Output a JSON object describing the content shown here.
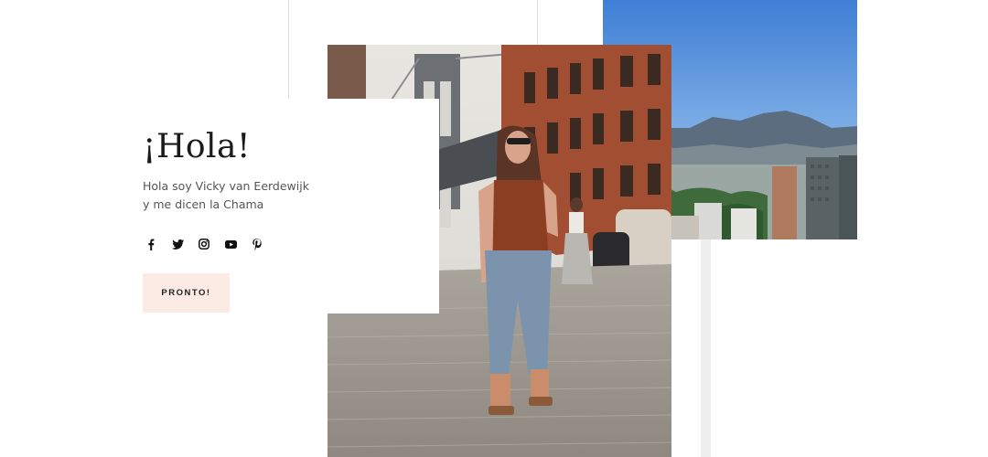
{
  "hero": {
    "title": "¡Hola!",
    "subtitle_line1": "Hola soy Vicky van Eerdewijk",
    "subtitle_line2": "y me dicen la Chama",
    "cta_label": "PRONTO!"
  },
  "social": [
    {
      "name": "facebook-icon"
    },
    {
      "name": "twitter-icon"
    },
    {
      "name": "instagram-icon"
    },
    {
      "name": "youtube-icon"
    },
    {
      "name": "pinterest-icon"
    }
  ],
  "colors": {
    "cta_background": "#fcebe5",
    "text_dark": "#1a1a1a",
    "text_muted": "#555555",
    "accent_line": "#e3dcd3"
  },
  "images": [
    {
      "name": "street-photo"
    },
    {
      "name": "city-mountain-photo"
    }
  ]
}
